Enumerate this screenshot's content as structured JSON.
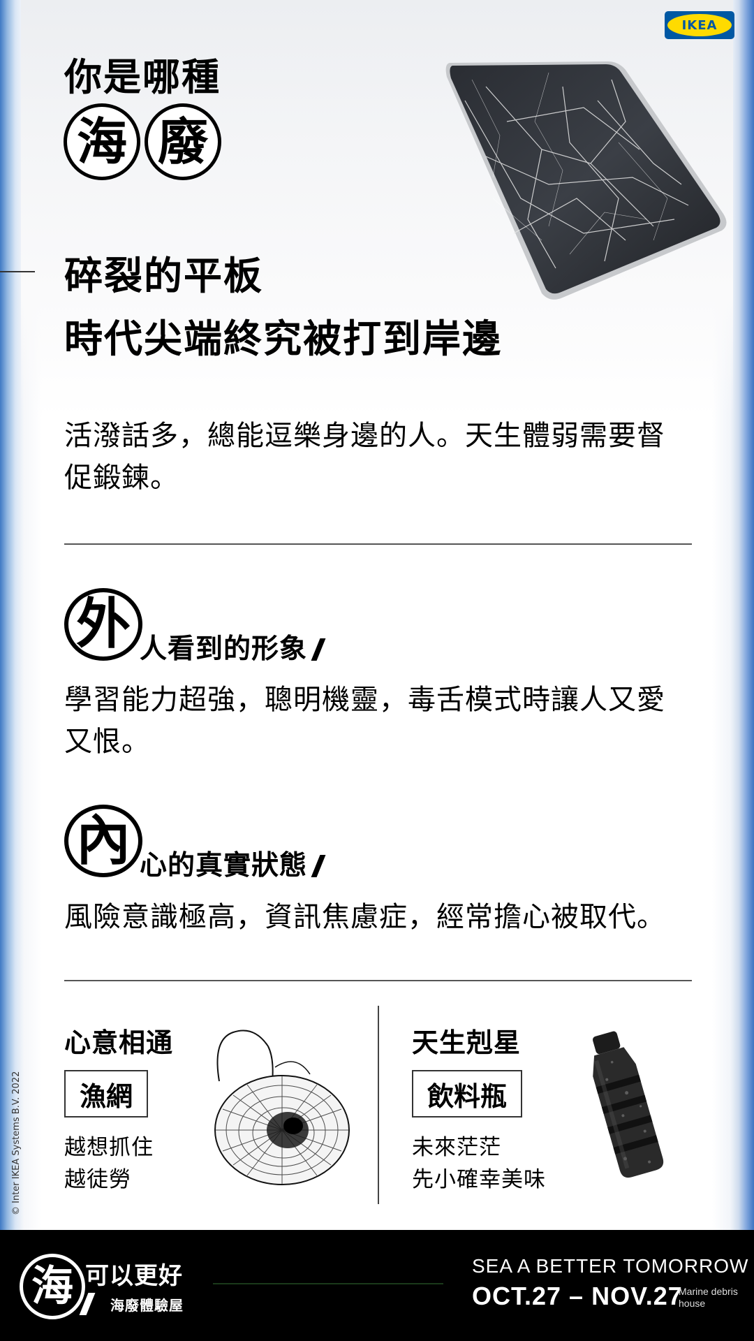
{
  "brand": {
    "logo_text": "IKEA",
    "logo_blue": "#0058a3",
    "logo_yellow": "#ffdb00"
  },
  "hero": {
    "question": "你是哪種",
    "circled": [
      "海",
      "廢"
    ],
    "subtitle_line1": "碎裂的平板",
    "subtitle_line2": "時代尖端終究被打到岸邊",
    "image_icon": "cracked-tablet"
  },
  "intro": {
    "text_line1": "活潑話多，總能逗樂身邊的人。天生體弱需要督",
    "text_line2": "促鍛鍊。"
  },
  "outer": {
    "circled": "外",
    "heading": "人看到的形象",
    "text_line1": "學習能力超強，聰明機靈，毒舌模式時讓人又愛",
    "text_line2": "又恨。"
  },
  "inner": {
    "circled": "內",
    "heading": "心的真實狀態",
    "text": "風險意識極高，資訊焦慮症，經常擔心被取代。"
  },
  "match": {
    "heading": "心意相通",
    "item": "漁網",
    "line1": "越想抓住",
    "line2": "越徒勞",
    "image_icon": "fishing-net"
  },
  "nemesis": {
    "heading": "天生剋星",
    "item": "飲料瓶",
    "line1": "未來茫茫",
    "line2": "先小確幸美味",
    "image_icon": "plastic-bottle"
  },
  "copyright": "© Inter IKEA Systems B.V. 2022",
  "footer": {
    "circled": "海",
    "title": "可以更好",
    "subtitle": "海廢體驗屋",
    "tagline": "SEA A BETTER TOMORROW",
    "dates": "OCT.27 – NOV.27",
    "md_line1": "Marine debris",
    "md_line2": "house"
  }
}
